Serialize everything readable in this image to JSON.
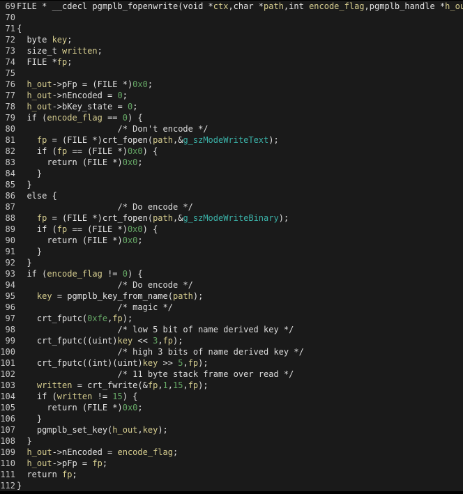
{
  "editor": {
    "colors": {
      "background": "#1a1a1a",
      "line_number": "#c8c8c8",
      "plain": "#e2e2e2",
      "variable": "#d6cd8f",
      "number": "#66a866",
      "comment": "#dcdcdc",
      "global": "#3bb3a9"
    },
    "lines": [
      {
        "num": "69",
        "tokens": [
          {
            "t": "FILE * __cdecl pgmplb_fopenwrite(void *",
            "c": "plain"
          },
          {
            "t": "ctx",
            "c": "variable"
          },
          {
            "t": ",char *",
            "c": "plain"
          },
          {
            "t": "path",
            "c": "variable"
          },
          {
            "t": ",int ",
            "c": "plain"
          },
          {
            "t": "encode_flag",
            "c": "variable"
          },
          {
            "t": ",pgmplb_handle *",
            "c": "plain"
          },
          {
            "t": "h_out",
            "c": "variable"
          },
          {
            "t": ")",
            "c": "plain"
          }
        ]
      },
      {
        "num": "70",
        "tokens": []
      },
      {
        "num": "71",
        "tokens": [
          {
            "t": "{",
            "c": "plain"
          }
        ]
      },
      {
        "num": "72",
        "tokens": [
          {
            "t": "  byte ",
            "c": "plain"
          },
          {
            "t": "key",
            "c": "variable"
          },
          {
            "t": ";",
            "c": "plain"
          }
        ]
      },
      {
        "num": "73",
        "tokens": [
          {
            "t": "  size_t ",
            "c": "plain"
          },
          {
            "t": "written",
            "c": "variable"
          },
          {
            "t": ";",
            "c": "plain"
          }
        ]
      },
      {
        "num": "74",
        "tokens": [
          {
            "t": "  FILE *",
            "c": "plain"
          },
          {
            "t": "fp",
            "c": "variable"
          },
          {
            "t": ";",
            "c": "plain"
          }
        ]
      },
      {
        "num": "75",
        "tokens": []
      },
      {
        "num": "76",
        "tokens": [
          {
            "t": "  ",
            "c": "plain"
          },
          {
            "t": "h_out",
            "c": "variable"
          },
          {
            "t": "->pFp = (FILE *)",
            "c": "plain"
          },
          {
            "t": "0x0",
            "c": "number"
          },
          {
            "t": ";",
            "c": "plain"
          }
        ]
      },
      {
        "num": "77",
        "tokens": [
          {
            "t": "  ",
            "c": "plain"
          },
          {
            "t": "h_out",
            "c": "variable"
          },
          {
            "t": "->nEncoded = ",
            "c": "plain"
          },
          {
            "t": "0",
            "c": "number"
          },
          {
            "t": ";",
            "c": "plain"
          }
        ]
      },
      {
        "num": "78",
        "tokens": [
          {
            "t": "  ",
            "c": "plain"
          },
          {
            "t": "h_out",
            "c": "variable"
          },
          {
            "t": "->bKey_state = ",
            "c": "plain"
          },
          {
            "t": "0",
            "c": "number"
          },
          {
            "t": ";",
            "c": "plain"
          }
        ]
      },
      {
        "num": "79",
        "tokens": [
          {
            "t": "  if (",
            "c": "plain"
          },
          {
            "t": "encode_flag",
            "c": "variable"
          },
          {
            "t": " == ",
            "c": "plain"
          },
          {
            "t": "0",
            "c": "number"
          },
          {
            "t": ") {",
            "c": "plain"
          }
        ]
      },
      {
        "num": "80",
        "tokens": [
          {
            "t": "                    /* Don't encode */",
            "c": "comment"
          }
        ]
      },
      {
        "num": "81",
        "tokens": [
          {
            "t": "    ",
            "c": "plain"
          },
          {
            "t": "fp",
            "c": "variable"
          },
          {
            "t": " = (FILE *)crt_fopen(",
            "c": "plain"
          },
          {
            "t": "path",
            "c": "variable"
          },
          {
            "t": ",&",
            "c": "plain"
          },
          {
            "t": "g_szModeWriteText",
            "c": "global"
          },
          {
            "t": ");",
            "c": "plain"
          }
        ]
      },
      {
        "num": "82",
        "tokens": [
          {
            "t": "    if (",
            "c": "plain"
          },
          {
            "t": "fp",
            "c": "variable"
          },
          {
            "t": " == (FILE *)",
            "c": "plain"
          },
          {
            "t": "0x0",
            "c": "number"
          },
          {
            "t": ") {",
            "c": "plain"
          }
        ]
      },
      {
        "num": "83",
        "tokens": [
          {
            "t": "      return (FILE *)",
            "c": "plain"
          },
          {
            "t": "0x0",
            "c": "number"
          },
          {
            "t": ";",
            "c": "plain"
          }
        ]
      },
      {
        "num": "84",
        "tokens": [
          {
            "t": "    }",
            "c": "plain"
          }
        ]
      },
      {
        "num": "85",
        "tokens": [
          {
            "t": "  }",
            "c": "plain"
          }
        ]
      },
      {
        "num": "86",
        "tokens": [
          {
            "t": "  else {",
            "c": "plain"
          }
        ]
      },
      {
        "num": "87",
        "tokens": [
          {
            "t": "                    /* Do encode */",
            "c": "comment"
          }
        ]
      },
      {
        "num": "88",
        "tokens": [
          {
            "t": "    ",
            "c": "plain"
          },
          {
            "t": "fp",
            "c": "variable"
          },
          {
            "t": " = (FILE *)crt_fopen(",
            "c": "plain"
          },
          {
            "t": "path",
            "c": "variable"
          },
          {
            "t": ",&",
            "c": "plain"
          },
          {
            "t": "g_szModeWriteBinary",
            "c": "global"
          },
          {
            "t": ");",
            "c": "plain"
          }
        ]
      },
      {
        "num": "89",
        "tokens": [
          {
            "t": "    if (",
            "c": "plain"
          },
          {
            "t": "fp",
            "c": "variable"
          },
          {
            "t": " == (FILE *)",
            "c": "plain"
          },
          {
            "t": "0x0",
            "c": "number"
          },
          {
            "t": ") {",
            "c": "plain"
          }
        ]
      },
      {
        "num": "90",
        "tokens": [
          {
            "t": "      return (FILE *)",
            "c": "plain"
          },
          {
            "t": "0x0",
            "c": "number"
          },
          {
            "t": ";",
            "c": "plain"
          }
        ]
      },
      {
        "num": "91",
        "tokens": [
          {
            "t": "    }",
            "c": "plain"
          }
        ]
      },
      {
        "num": "92",
        "tokens": [
          {
            "t": "  }",
            "c": "plain"
          }
        ]
      },
      {
        "num": "93",
        "tokens": [
          {
            "t": "  if (",
            "c": "plain"
          },
          {
            "t": "encode_flag",
            "c": "variable"
          },
          {
            "t": " != ",
            "c": "plain"
          },
          {
            "t": "0",
            "c": "number"
          },
          {
            "t": ") {",
            "c": "plain"
          }
        ]
      },
      {
        "num": "94",
        "tokens": [
          {
            "t": "                    /* Do encode */",
            "c": "comment"
          }
        ]
      },
      {
        "num": "95",
        "tokens": [
          {
            "t": "    ",
            "c": "plain"
          },
          {
            "t": "key",
            "c": "variable"
          },
          {
            "t": " = pgmplb_key_from_name(",
            "c": "plain"
          },
          {
            "t": "path",
            "c": "variable"
          },
          {
            "t": ");",
            "c": "plain"
          }
        ]
      },
      {
        "num": "96",
        "tokens": [
          {
            "t": "                    /* magic */",
            "c": "comment"
          }
        ]
      },
      {
        "num": "97",
        "tokens": [
          {
            "t": "    crt_fputc(",
            "c": "plain"
          },
          {
            "t": "0xfe",
            "c": "number"
          },
          {
            "t": ",",
            "c": "plain"
          },
          {
            "t": "fp",
            "c": "variable"
          },
          {
            "t": ");",
            "c": "plain"
          }
        ]
      },
      {
        "num": "98",
        "tokens": [
          {
            "t": "                    /* low 5 bit of name derived key */",
            "c": "comment"
          }
        ]
      },
      {
        "num": "99",
        "tokens": [
          {
            "t": "    crt_fputc((uint)",
            "c": "plain"
          },
          {
            "t": "key",
            "c": "variable"
          },
          {
            "t": " << ",
            "c": "plain"
          },
          {
            "t": "3",
            "c": "number"
          },
          {
            "t": ",",
            "c": "plain"
          },
          {
            "t": "fp",
            "c": "variable"
          },
          {
            "t": ");",
            "c": "plain"
          }
        ]
      },
      {
        "num": "100",
        "tokens": [
          {
            "t": "                    /* high 3 bits of name derived key */",
            "c": "comment"
          }
        ]
      },
      {
        "num": "101",
        "tokens": [
          {
            "t": "    crt_fputc((int)(uint)",
            "c": "plain"
          },
          {
            "t": "key",
            "c": "variable"
          },
          {
            "t": " >> ",
            "c": "plain"
          },
          {
            "t": "5",
            "c": "number"
          },
          {
            "t": ",",
            "c": "plain"
          },
          {
            "t": "fp",
            "c": "variable"
          },
          {
            "t": ");",
            "c": "plain"
          }
        ]
      },
      {
        "num": "102",
        "tokens": [
          {
            "t": "                    /* 11 byte stack frame over read */",
            "c": "comment"
          }
        ]
      },
      {
        "num": "103",
        "tokens": [
          {
            "t": "    ",
            "c": "plain"
          },
          {
            "t": "written",
            "c": "variable"
          },
          {
            "t": " = crt_fwrite(&",
            "c": "plain"
          },
          {
            "t": "fp",
            "c": "variable"
          },
          {
            "t": ",",
            "c": "plain"
          },
          {
            "t": "1",
            "c": "number"
          },
          {
            "t": ",",
            "c": "plain"
          },
          {
            "t": "15",
            "c": "number"
          },
          {
            "t": ",",
            "c": "plain"
          },
          {
            "t": "fp",
            "c": "variable"
          },
          {
            "t": ");",
            "c": "plain"
          }
        ]
      },
      {
        "num": "104",
        "tokens": [
          {
            "t": "    if (",
            "c": "plain"
          },
          {
            "t": "written",
            "c": "variable"
          },
          {
            "t": " != ",
            "c": "plain"
          },
          {
            "t": "15",
            "c": "number"
          },
          {
            "t": ") {",
            "c": "plain"
          }
        ]
      },
      {
        "num": "105",
        "tokens": [
          {
            "t": "      return (FILE *)",
            "c": "plain"
          },
          {
            "t": "0x0",
            "c": "number"
          },
          {
            "t": ";",
            "c": "plain"
          }
        ]
      },
      {
        "num": "106",
        "tokens": [
          {
            "t": "    }",
            "c": "plain"
          }
        ]
      },
      {
        "num": "107",
        "tokens": [
          {
            "t": "    pgmplb_set_key(",
            "c": "plain"
          },
          {
            "t": "h_out",
            "c": "variable"
          },
          {
            "t": ",",
            "c": "plain"
          },
          {
            "t": "key",
            "c": "variable"
          },
          {
            "t": ");",
            "c": "plain"
          }
        ]
      },
      {
        "num": "108",
        "tokens": [
          {
            "t": "  }",
            "c": "plain"
          }
        ]
      },
      {
        "num": "109",
        "tokens": [
          {
            "t": "  ",
            "c": "plain"
          },
          {
            "t": "h_out",
            "c": "variable"
          },
          {
            "t": "->nEncoded = ",
            "c": "plain"
          },
          {
            "t": "encode_flag",
            "c": "variable"
          },
          {
            "t": ";",
            "c": "plain"
          }
        ]
      },
      {
        "num": "110",
        "tokens": [
          {
            "t": "  ",
            "c": "plain"
          },
          {
            "t": "h_out",
            "c": "variable"
          },
          {
            "t": "->pFp = ",
            "c": "plain"
          },
          {
            "t": "fp",
            "c": "variable"
          },
          {
            "t": ";",
            "c": "plain"
          }
        ]
      },
      {
        "num": "111",
        "tokens": [
          {
            "t": "  return ",
            "c": "plain"
          },
          {
            "t": "fp",
            "c": "variable"
          },
          {
            "t": ";",
            "c": "plain"
          }
        ]
      },
      {
        "num": "112",
        "tokens": [
          {
            "t": "}",
            "c": "plain"
          }
        ]
      }
    ]
  }
}
